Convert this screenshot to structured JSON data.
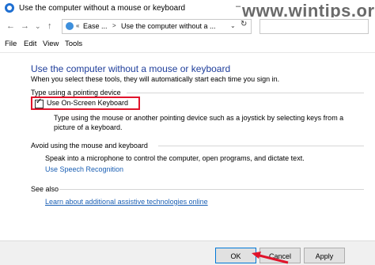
{
  "window": {
    "title": "Use the computer without a mouse or keyboard",
    "minimize_glyph": "–",
    "watermark": "www.wintips.org"
  },
  "nav": {
    "back_glyph": "←",
    "forward_glyph": "→",
    "up_glyph": "↑",
    "address": {
      "prefix": "«",
      "seg1": "Ease ...",
      "sep_glyph": ">",
      "seg2": "Use the computer without a ...",
      "dropdown_glyph": "⌄",
      "refresh_glyph": "↻"
    }
  },
  "menu": [
    "File",
    "Edit",
    "View",
    "Tools"
  ],
  "page": {
    "heading": "Use the computer without a mouse or keyboard",
    "subtext": "When you select these tools, they will automatically start each time you sign in."
  },
  "pointing": {
    "title": "Type using a pointing device",
    "checkbox_label": "Use On-Screen Keyboard",
    "checked_glyph": "✓",
    "description": "Type using the mouse or another pointing device such as a joystick by selecting keys from a picture of a keyboard."
  },
  "avoid": {
    "title": "Avoid using the mouse and keyboard",
    "text": "Speak into a microphone to control the computer, open programs, and dictate text.",
    "link": "Use Speech Recognition"
  },
  "see_also": {
    "title": "See also",
    "link": "Learn about additional assistive technologies online"
  },
  "buttons": {
    "ok": "OK",
    "cancel": "Cancel",
    "apply": "Apply"
  },
  "colors": {
    "heading": "#1e3d9a",
    "link": "#1a5fb4",
    "highlight": "#e0142b"
  }
}
